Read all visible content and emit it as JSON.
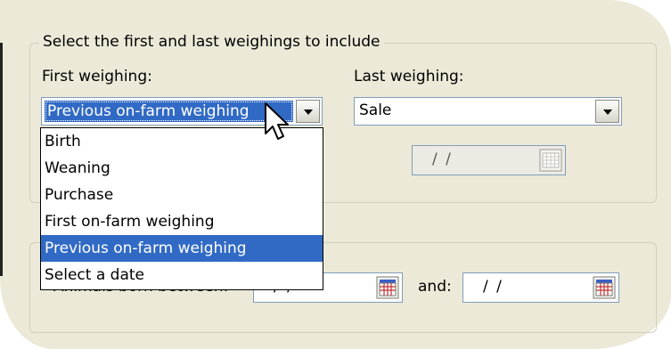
{
  "range_group": {
    "title": "Select the first and last weighings to include",
    "first_label": "First weighing:",
    "first_value": "Previous on-farm weighing",
    "last_label": "Last weighing:",
    "last_value": "Sale",
    "last_date": "/ /"
  },
  "dropdown": {
    "options": [
      "Birth",
      "Weaning",
      "Purchase",
      "First on-farm weighing",
      "Previous on-farm weighing",
      "Select a date"
    ],
    "highlighted": "Previous on-farm weighing"
  },
  "born_group": {
    "label": "Animals born between:",
    "from_date": "/ /",
    "and_label": "and:",
    "to_date": "/ /"
  },
  "icons": {
    "dropdown_arrow": "chevron-down-icon",
    "calendar": "calendar-icon",
    "pointer": "mouse-pointer-icon"
  },
  "colors": {
    "selection": "#316ac5",
    "panel": "#ece9d8",
    "input_border": "#7f9db9"
  }
}
